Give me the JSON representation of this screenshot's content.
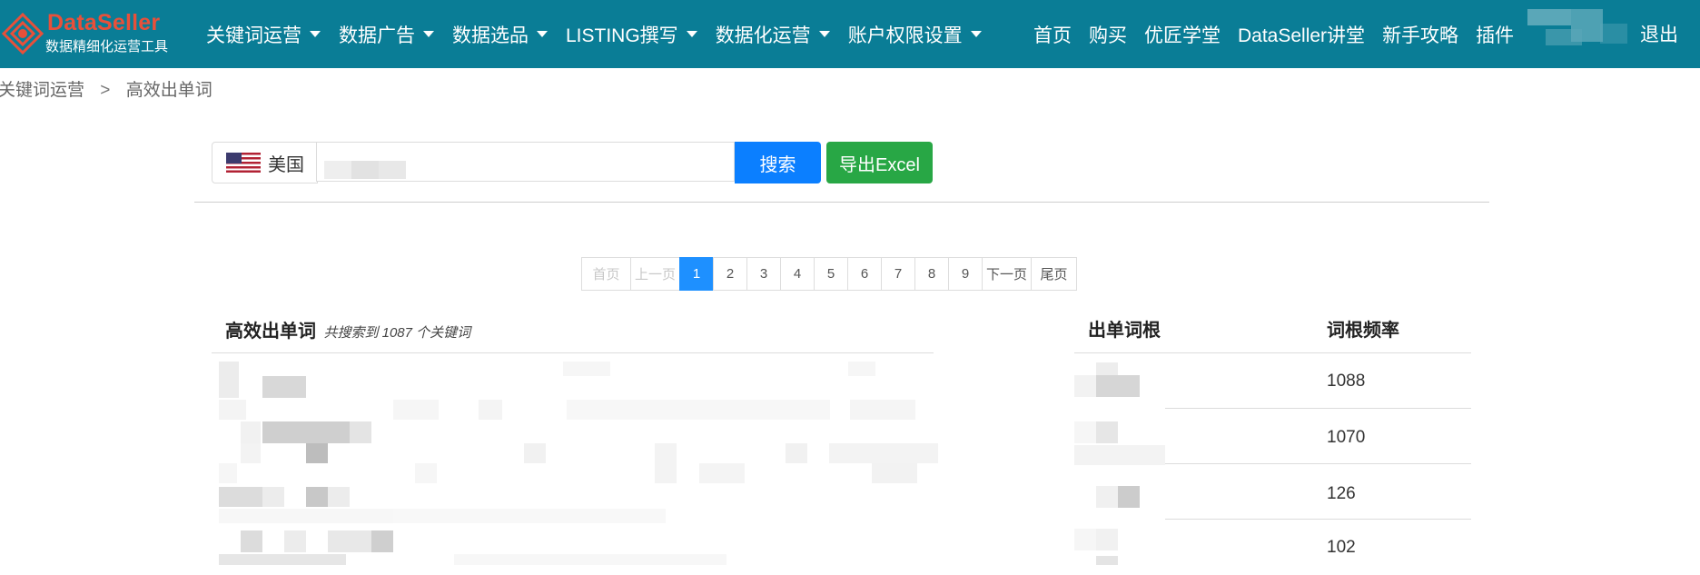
{
  "brand": {
    "name": "DataSeller",
    "tagline": "数据精细化运营工具",
    "colors": {
      "navbar": "#0a7d96",
      "logo": "#e8503a"
    }
  },
  "nav": {
    "menus": [
      {
        "label": "关键词运营"
      },
      {
        "label": "数据广告"
      },
      {
        "label": "数据选品"
      },
      {
        "label": "LISTING撰写"
      },
      {
        "label": "数据化运营"
      },
      {
        "label": "账户权限设置"
      }
    ],
    "links": [
      {
        "label": "首页"
      },
      {
        "label": "购买"
      },
      {
        "label": "优匠学堂"
      },
      {
        "label": "DataSeller讲堂"
      },
      {
        "label": "新手攻略"
      },
      {
        "label": "插件"
      }
    ],
    "logout": "退出"
  },
  "breadcrumb": {
    "parent": "关键词运营",
    "separator": ">",
    "current": "高效出单词"
  },
  "search": {
    "country": "美国",
    "country_icon": "us-flag-icon",
    "button": "搜索",
    "export_button": "导出Excel",
    "colors": {
      "search": "#0b7fff",
      "export": "#28a745"
    }
  },
  "pagination": {
    "first": "首页",
    "prev": "上一页",
    "pages": [
      "1",
      "2",
      "3",
      "4",
      "5",
      "6",
      "7",
      "8",
      "9"
    ],
    "current": "1",
    "next": "下一页",
    "last": "尾页"
  },
  "results": {
    "title": "高效出单词",
    "count_text": "共搜索到 1087 个关键词"
  },
  "stats": {
    "col_root": "出单词根",
    "col_freq": "词根频率",
    "rows": [
      {
        "freq": "1088"
      },
      {
        "freq": "1070"
      },
      {
        "freq": "126"
      },
      {
        "freq": "102"
      }
    ]
  }
}
